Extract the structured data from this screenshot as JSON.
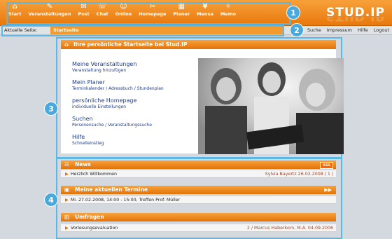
{
  "nav": [
    {
      "label": "Start",
      "icon": "home-icon",
      "glyph": "⌂"
    },
    {
      "label": "Veranstaltungen",
      "icon": "courses-icon",
      "glyph": "✎"
    },
    {
      "label": "Post",
      "icon": "mail-icon",
      "glyph": "✉"
    },
    {
      "label": "Chat",
      "icon": "chat-icon",
      "glyph": "☏"
    },
    {
      "label": "Online",
      "icon": "online-icon",
      "glyph": "☺"
    },
    {
      "label": "Homepage",
      "icon": "homepage-icon",
      "glyph": "✂"
    },
    {
      "label": "Planer",
      "icon": "planner-icon",
      "glyph": "▦"
    },
    {
      "label": "Mensa",
      "icon": "mensa-icon",
      "glyph": "¥"
    },
    {
      "label": "Memo",
      "icon": "memo-icon",
      "glyph": "✧"
    }
  ],
  "logo": "STUD.IP",
  "callouts": [
    "1",
    "2",
    "3",
    "4"
  ],
  "breadcrumbs": {
    "label": "Aktuelle Seite:",
    "active": "Startseite"
  },
  "top_links": [
    "Suche",
    "Impressum",
    "Hilfe",
    "Logout"
  ],
  "start": {
    "title": "Ihre persönliche Startseite bei Stud.IP",
    "links": [
      {
        "title": "Meine Veranstaltungen",
        "sub": "Veranstaltung hinzufügen"
      },
      {
        "title": "Mein Planer",
        "sub": "Terminkalender / Adressbuch / Stundenplan"
      },
      {
        "title": "persönliche Homepage",
        "sub": "individuelle Einstellungen"
      },
      {
        "title": "Suchen",
        "sub": "Personensuche / Veranstaltungssuche"
      },
      {
        "title": "Hilfe",
        "sub": "Schnelleinstieg"
      }
    ]
  },
  "news": {
    "title": "News",
    "rss": "RSS",
    "item": "Herzlich Willkommen",
    "meta": "Sylvia Bayertz 26.02.2008 | 1 |"
  },
  "termine": {
    "title": "Meine aktuellen Termine",
    "item": "Mi. 27.02.2008, 14:00 - 15:00, Treffen Prof. Müller"
  },
  "umfragen": {
    "title": "Umfragen",
    "item": "Vorlesungsevaluation",
    "meta": "2 / Marcus Haberkorn, M.A. 04.09.2006"
  }
}
